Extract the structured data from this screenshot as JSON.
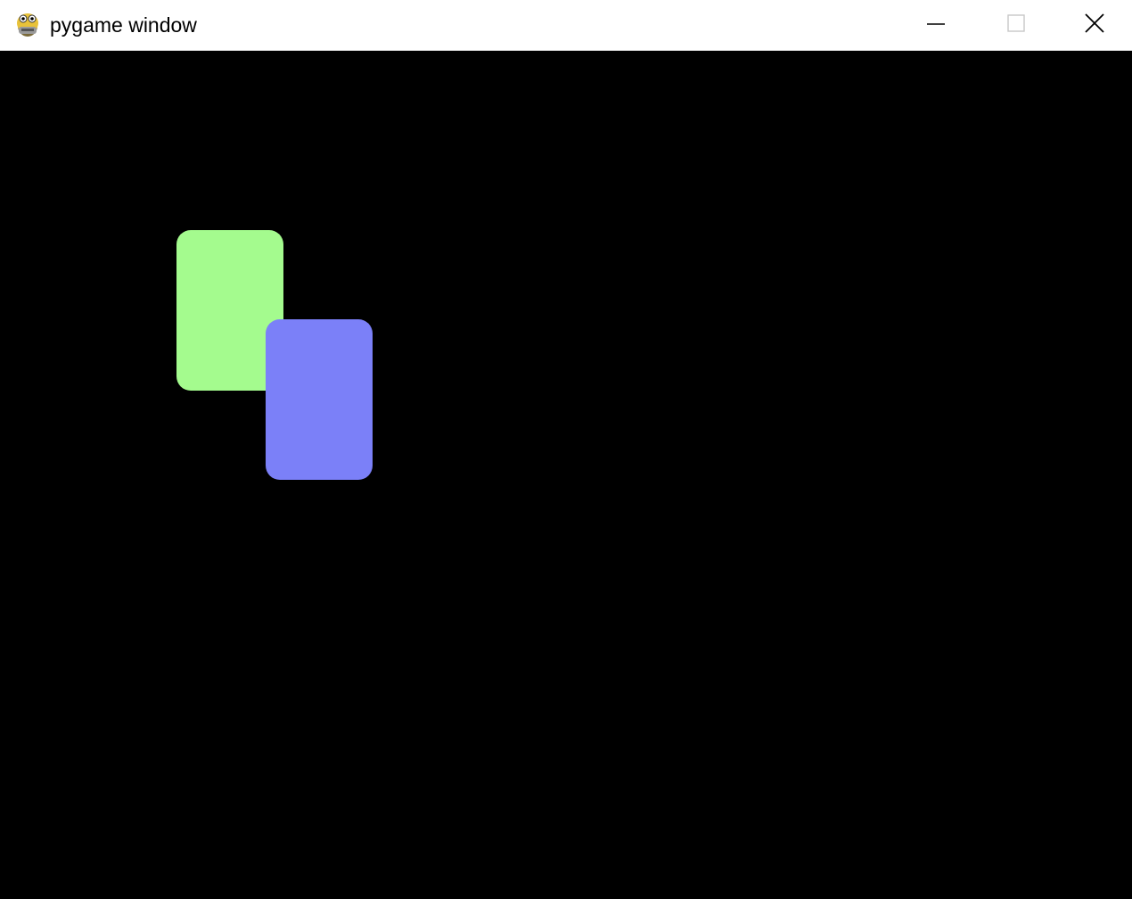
{
  "window": {
    "title": "pygame window"
  },
  "titlebar": {
    "icon": "pygame-snake-icon",
    "controls": [
      "minimize-icon",
      "maximize-icon",
      "close-icon"
    ]
  },
  "canvas": {
    "background": "#000000",
    "cards": [
      {
        "name": "green-card",
        "color": "#a4fb8e"
      },
      {
        "name": "blue-card",
        "color": "#7b80f8"
      }
    ]
  }
}
